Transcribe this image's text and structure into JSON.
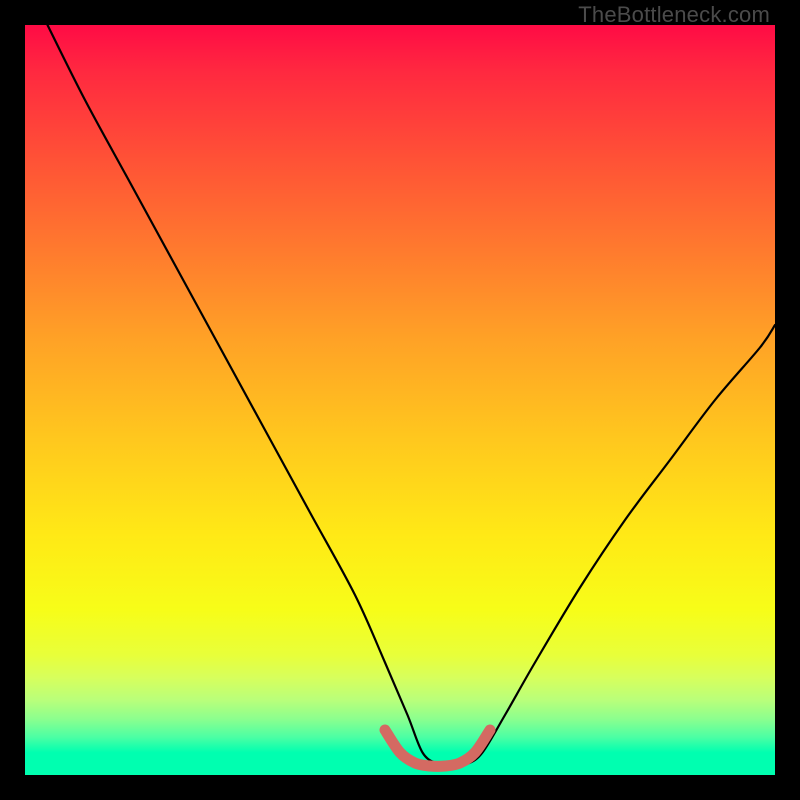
{
  "watermark": {
    "text": "TheBottleneck.com"
  },
  "gradient": {
    "stops": [
      {
        "pos": 0.0,
        "color": "#ff0b45"
      },
      {
        "pos": 0.06,
        "color": "#ff2840"
      },
      {
        "pos": 0.18,
        "color": "#ff5236"
      },
      {
        "pos": 0.3,
        "color": "#ff7a2e"
      },
      {
        "pos": 0.42,
        "color": "#ffa226"
      },
      {
        "pos": 0.55,
        "color": "#ffc71e"
      },
      {
        "pos": 0.68,
        "color": "#ffe916"
      },
      {
        "pos": 0.78,
        "color": "#f7fd18"
      },
      {
        "pos": 0.84,
        "color": "#e8ff3a"
      },
      {
        "pos": 0.87,
        "color": "#d7ff5c"
      },
      {
        "pos": 0.9,
        "color": "#b9ff7a"
      },
      {
        "pos": 0.925,
        "color": "#8cff8e"
      },
      {
        "pos": 0.95,
        "color": "#4affa4"
      },
      {
        "pos": 0.97,
        "color": "#00ffb0"
      },
      {
        "pos": 1.0,
        "color": "#00ffb0"
      }
    ]
  },
  "chart_data": {
    "type": "line",
    "title": "",
    "xlabel": "",
    "ylabel": "",
    "xlim": [
      0,
      100
    ],
    "ylim": [
      0,
      100
    ],
    "series": [
      {
        "name": "main-curve",
        "color": "#000000",
        "x": [
          3,
          8,
          14,
          20,
          26,
          32,
          38,
          44,
          48,
          51,
          53,
          55,
          57,
          59,
          61,
          64,
          68,
          74,
          80,
          86,
          92,
          98,
          100
        ],
        "y": [
          100,
          90,
          79,
          68,
          57,
          46,
          35,
          24,
          15,
          8,
          3,
          1.5,
          1.2,
          1.5,
          3,
          8,
          15,
          25,
          34,
          42,
          50,
          57,
          60
        ]
      },
      {
        "name": "bottom-highlight",
        "color": "#d46a62",
        "x": [
          48,
          50,
          52,
          54,
          56,
          58,
          60,
          62
        ],
        "y": [
          6,
          3,
          1.6,
          1.2,
          1.2,
          1.6,
          3,
          6
        ]
      }
    ]
  }
}
